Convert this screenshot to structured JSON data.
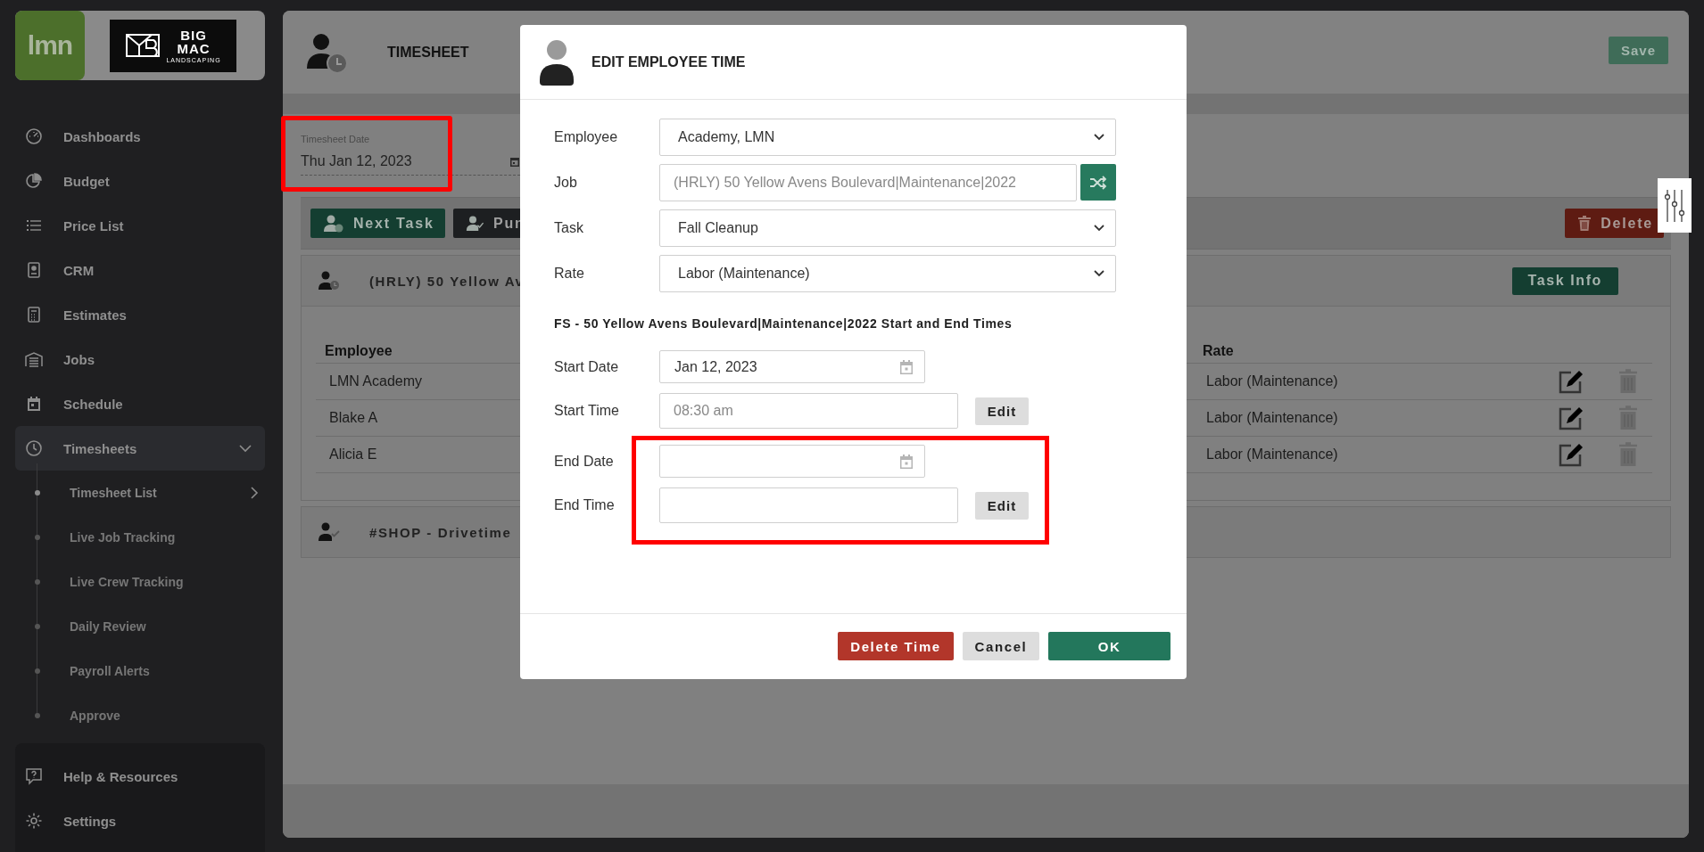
{
  "sidebar": {
    "logo_text": "lmn",
    "company_logo": [
      "BIG",
      "MAC",
      "LANDSCAPING"
    ],
    "items": [
      {
        "label": "Dashboards",
        "selected": false
      },
      {
        "label": "Budget",
        "selected": false
      },
      {
        "label": "Price List",
        "selected": false
      },
      {
        "label": "CRM",
        "selected": false
      },
      {
        "label": "Estimates",
        "selected": false
      },
      {
        "label": "Jobs",
        "selected": false
      },
      {
        "label": "Schedule",
        "selected": false
      },
      {
        "label": "Timesheets",
        "selected": true,
        "expanded": true,
        "children": [
          {
            "label": "Timesheet List",
            "selected": true,
            "has_submenu": true
          },
          {
            "label": "Live Job Tracking",
            "selected": false,
            "has_submenu": false
          },
          {
            "label": "Live Crew Tracking",
            "selected": false,
            "has_submenu": false
          },
          {
            "label": "Daily Review",
            "selected": false,
            "has_submenu": false
          },
          {
            "label": "Payroll Alerts",
            "selected": false,
            "has_submenu": false
          },
          {
            "label": "Approve",
            "selected": false,
            "has_submenu": false
          }
        ]
      }
    ],
    "footer_items": [
      {
        "label": "Help & Resources"
      },
      {
        "label": "Settings"
      }
    ]
  },
  "page": {
    "title": "TIMESHEET",
    "save_label": "Save",
    "date_field": {
      "label": "Timesheet Date",
      "value": "Thu Jan 12, 2023"
    },
    "toolbar": [
      {
        "label": "Next Task",
        "kind": "next"
      },
      {
        "label": "Pun",
        "kind": "punch"
      }
    ],
    "delete_label": "Delete",
    "tasks": [
      {
        "title": "(HRLY) 50 Yellow Av",
        "kind": "clock",
        "info_label": "Task Info",
        "columns": [
          "Employee",
          "Rate"
        ],
        "rows": [
          {
            "employee": "LMN Academy",
            "rate": "Labor (Maintenance)"
          },
          {
            "employee": "Blake A",
            "rate": "Labor (Maintenance)"
          },
          {
            "employee": "Alicia E",
            "rate": "Labor (Maintenance)"
          }
        ]
      },
      {
        "title": "#SHOP - Drivetime",
        "kind": "check"
      }
    ]
  },
  "dialog": {
    "title": "EDIT EMPLOYEE TIME",
    "fields": [
      {
        "label": "Employee",
        "kind": "select",
        "value": "Academy, LMN"
      },
      {
        "label": "Job",
        "kind": "readonly",
        "value": "(HRLY) 50 Yellow Avens Boulevard|Maintenance|2022"
      },
      {
        "label": "Task",
        "kind": "select",
        "value": "Fall Cleanup"
      },
      {
        "label": "Rate",
        "kind": "select",
        "value": "Labor (Maintenance)"
      }
    ],
    "section_heading": "FS - 50 Yellow Avens Boulevard|Maintenance|2022 Start and End Times",
    "time_fields": [
      {
        "label": "Start Date",
        "kind": "date",
        "value": "Jan 12, 2023"
      },
      {
        "label": "Start Time",
        "kind": "time",
        "value": "08:30 am",
        "edit_label": "Edit"
      },
      {
        "label": "End Date",
        "kind": "date"
      },
      {
        "label": "End Time",
        "kind": "time",
        "edit_label": "Edit"
      }
    ],
    "buttons": [
      {
        "label": "Delete Time",
        "kind": "danger"
      },
      {
        "label": "Cancel",
        "kind": "secondary"
      },
      {
        "label": "OK",
        "kind": "primary"
      }
    ]
  }
}
